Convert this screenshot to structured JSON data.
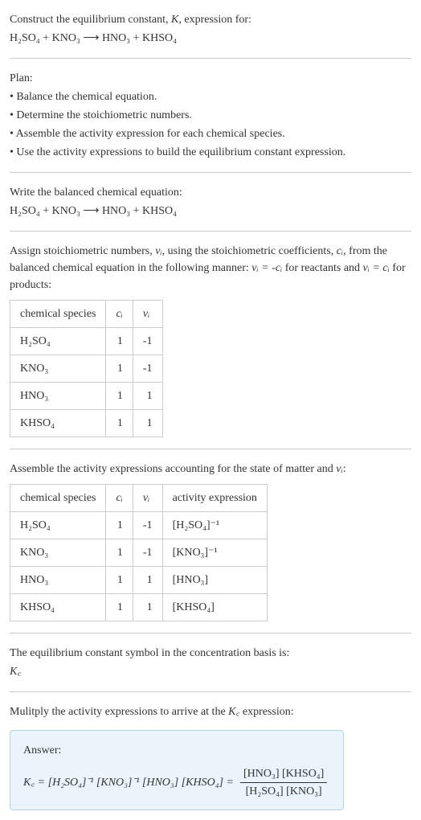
{
  "title": {
    "line1_pre": "Construct the equilibrium constant, ",
    "K": "K",
    "line1_post": ", expression for:",
    "equation": "H₂SO₄ + KNO₃ ⟶ HNO₃ + KHSO₄"
  },
  "plan": {
    "heading": "Plan:",
    "items": [
      "• Balance the chemical equation.",
      "• Determine the stoichiometric numbers.",
      "• Assemble the activity expression for each chemical species.",
      "• Use the activity expressions to build the equilibrium constant expression."
    ]
  },
  "balanced": {
    "heading": "Write the balanced chemical equation:",
    "equation": "H₂SO₄ + KNO₃ ⟶ HNO₃ + KHSO₄"
  },
  "assign": {
    "text_a": "Assign stoichiometric numbers, ",
    "nu_i": "νᵢ",
    "text_b": ", using the stoichiometric coefficients, ",
    "c_i": "cᵢ",
    "text_c": ", from the balanced chemical equation in the following manner: ",
    "rel1": "νᵢ = -cᵢ",
    "text_d": " for reactants and ",
    "rel2": "νᵢ = cᵢ",
    "text_e": " for products:"
  },
  "table1": {
    "headers": [
      "chemical species",
      "cᵢ",
      "νᵢ"
    ],
    "rows": [
      [
        "H₂SO₄",
        "1",
        "-1"
      ],
      [
        "KNO₃",
        "1",
        "-1"
      ],
      [
        "HNO₃",
        "1",
        "1"
      ],
      [
        "KHSO₄",
        "1",
        "1"
      ]
    ]
  },
  "assemble": {
    "text_a": "Assemble the activity expressions accounting for the state of matter and ",
    "nu_i": "νᵢ",
    "text_b": ":"
  },
  "table2": {
    "headers": [
      "chemical species",
      "cᵢ",
      "νᵢ",
      "activity expression"
    ],
    "rows": [
      [
        "H₂SO₄",
        "1",
        "-1",
        "[H₂SO₄]⁻¹"
      ],
      [
        "KNO₃",
        "1",
        "-1",
        "[KNO₃]⁻¹"
      ],
      [
        "HNO₃",
        "1",
        "1",
        "[HNO₃]"
      ],
      [
        "KHSO₄",
        "1",
        "1",
        "[KHSO₄]"
      ]
    ]
  },
  "symbol": {
    "line1": "The equilibrium constant symbol in the concentration basis is:",
    "kc": "K꜀"
  },
  "multiply": {
    "text_a": "Mulitply the activity expressions to arrive at the ",
    "kc": "K꜀",
    "text_b": " expression:"
  },
  "answer": {
    "label": "Answer:",
    "lhs": "K꜀ = [H₂SO₄]⁻¹ [KNO₃]⁻¹ [HNO₃] [KHSO₄] = ",
    "frac_top": "[HNO₃] [KHSO₄]",
    "frac_bot": "[H₂SO₄] [KNO₃]"
  },
  "chart_data": {
    "type": "table",
    "tables": [
      {
        "headers": [
          "chemical species",
          "c_i",
          "nu_i"
        ],
        "rows": [
          {
            "chemical species": "H2SO4",
            "c_i": 1,
            "nu_i": -1
          },
          {
            "chemical species": "KNO3",
            "c_i": 1,
            "nu_i": -1
          },
          {
            "chemical species": "HNO3",
            "c_i": 1,
            "nu_i": 1
          },
          {
            "chemical species": "KHSO4",
            "c_i": 1,
            "nu_i": 1
          }
        ]
      },
      {
        "headers": [
          "chemical species",
          "c_i",
          "nu_i",
          "activity expression"
        ],
        "rows": [
          {
            "chemical species": "H2SO4",
            "c_i": 1,
            "nu_i": -1,
            "activity expression": "[H2SO4]^-1"
          },
          {
            "chemical species": "KNO3",
            "c_i": 1,
            "nu_i": -1,
            "activity expression": "[KNO3]^-1"
          },
          {
            "chemical species": "HNO3",
            "c_i": 1,
            "nu_i": 1,
            "activity expression": "[HNO3]"
          },
          {
            "chemical species": "KHSO4",
            "c_i": 1,
            "nu_i": 1,
            "activity expression": "[KHSO4]"
          }
        ]
      }
    ]
  }
}
